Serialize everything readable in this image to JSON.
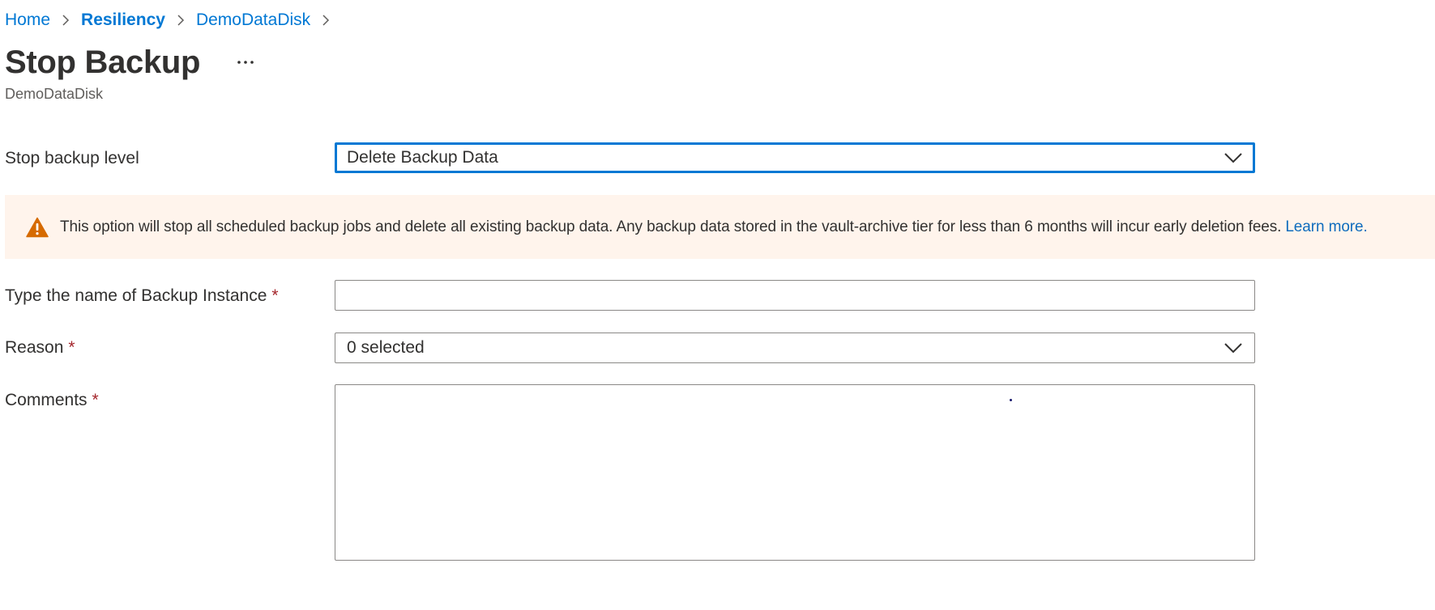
{
  "breadcrumb": {
    "items": [
      {
        "label": "Home"
      },
      {
        "label": "Resiliency"
      },
      {
        "label": "DemoDataDisk"
      }
    ]
  },
  "header": {
    "title": "Stop Backup",
    "more_label": "...",
    "subtitle": "DemoDataDisk"
  },
  "form": {
    "stop_backup_level": {
      "label": "Stop backup level",
      "value": "Delete Backup Data"
    },
    "warning": {
      "text": "This option will stop all scheduled backup jobs and delete all existing backup data. Any backup data stored in the vault-archive tier for less than 6 months will incur early deletion fees.",
      "link_label": "Learn more."
    },
    "instance_name": {
      "label": "Type the name of Backup Instance",
      "required_mark": "*",
      "value": ""
    },
    "reason": {
      "label": "Reason",
      "required_mark": "*",
      "value": "0 selected"
    },
    "comments": {
      "label": "Comments",
      "required_mark": "*",
      "value": ""
    }
  },
  "colors": {
    "link": "#0078d4",
    "focus_border": "#0078d4",
    "warning_background": "#fff4ec",
    "warning_icon": "#d66a00",
    "required": "#a4262c"
  }
}
